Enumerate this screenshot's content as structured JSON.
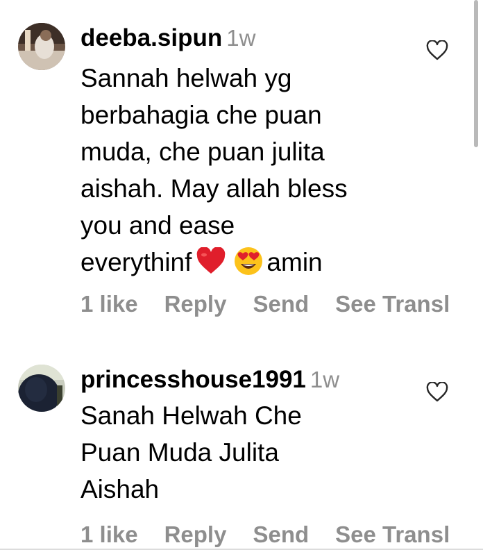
{
  "comments": [
    {
      "username": "deeba.sipun",
      "time": "1w",
      "text_main": "Sannah helwah yg\nberbahagia che puan\nmuda, che puan julita\naishah. May allah bless\nyou and  ease\neverythinf",
      "text_tail": "amin",
      "emojis": [
        "red-heart-emoji",
        "heart-eyes-emoji"
      ],
      "likes": "1 like",
      "reply_label": "Reply",
      "send_label": "Send",
      "translate_label": "See Transl"
    },
    {
      "username": "princesshouse1991",
      "time": "1w",
      "text_main": "Sanah Helwah Che\nPuan Muda Julita\nAishah",
      "likes": "1 like",
      "reply_label": "Reply",
      "send_label": "Send",
      "translate_label": "See Transl"
    }
  ],
  "icons": {
    "like": "heart-outline-icon"
  },
  "colors": {
    "text": "#000000",
    "secondary": "#8e8e8e",
    "background": "#ffffff"
  }
}
